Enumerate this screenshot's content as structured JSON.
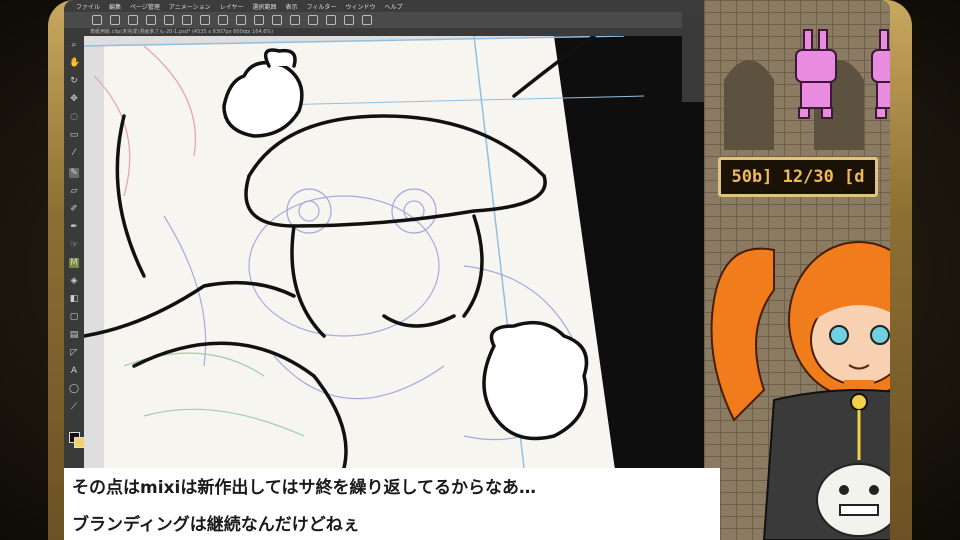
{
  "menu": {
    "items": [
      "ファイル",
      "編集",
      "ページ管理",
      "アニメーション",
      "レイヤー",
      "選択範囲",
      "表示",
      "フィルター",
      "ウィンドウ",
      "ヘルプ"
    ]
  },
  "document_tab": "表紙用絵.clip(未完成)漫画家さん-20-1.psd* (4535 x 6307px 600dpi 164.6%)",
  "game": {
    "counter": "50b] 12/30 [d"
  },
  "subtitles": {
    "line1": "その点はmixiは新作出してはサ終を繰り返してるからなあ…",
    "line2": "ブランディングは継続なんだけどねぇ"
  },
  "colors": {
    "frame_gold": "#c9a85e",
    "counter_text": "#f1b95a",
    "bunny_pink": "#e98ce0",
    "hair_orange": "#f07c1c"
  },
  "icons": [
    "zoom-icon",
    "hand-icon",
    "rotate-icon",
    "move-icon",
    "lasso-icon",
    "marquee-icon",
    "eyedropper-icon",
    "pen-icon",
    "eraser-icon",
    "brush-icon",
    "airbrush-icon",
    "fill-icon",
    "gradient-icon",
    "figure-icon",
    "text-icon",
    "balloon-icon",
    "ruler-icon"
  ]
}
